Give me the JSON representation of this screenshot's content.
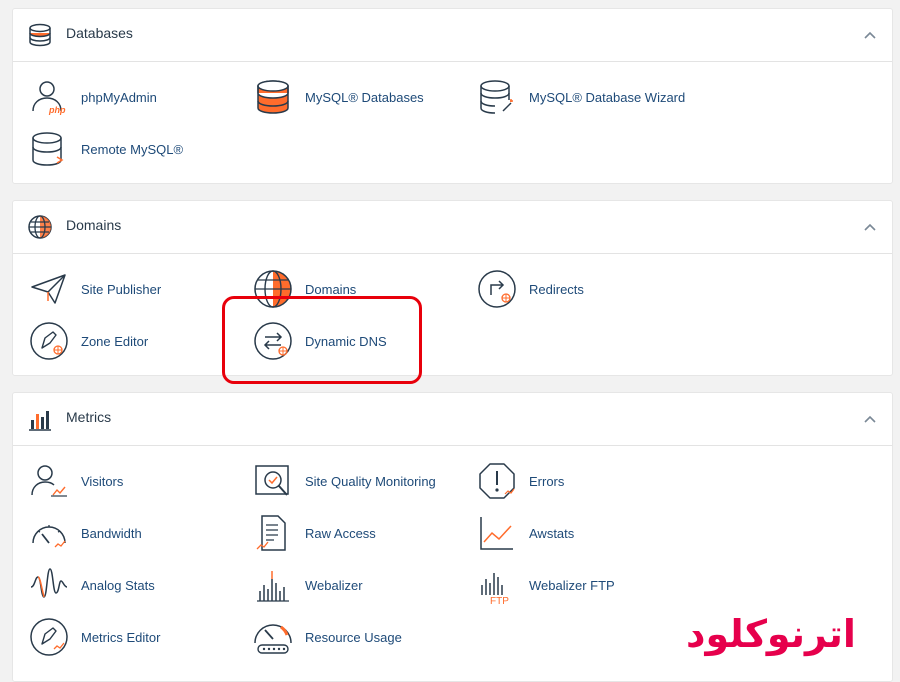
{
  "colors": {
    "accent": "#ff6c2c",
    "link": "#1e4a78",
    "highlight": "#e8000b",
    "watermark": "#e6004c"
  },
  "sections": [
    {
      "title": "Databases",
      "icon": "database-icon",
      "items": [
        {
          "label": "phpMyAdmin",
          "icon": "phpmyadmin-icon"
        },
        {
          "label": "MySQL® Databases",
          "icon": "mysql-databases-icon"
        },
        {
          "label": "MySQL® Database Wizard",
          "icon": "mysql-wizard-icon"
        },
        {
          "label": "Remote MySQL®",
          "icon": "remote-mysql-icon"
        }
      ]
    },
    {
      "title": "Domains",
      "icon": "globe-icon",
      "items": [
        {
          "label": "Site Publisher",
          "icon": "paper-plane-icon"
        },
        {
          "label": "Domains",
          "icon": "domains-globe-icon"
        },
        {
          "label": "Redirects",
          "icon": "redirect-icon"
        },
        {
          "label": "Zone Editor",
          "icon": "zone-editor-icon"
        },
        {
          "label": "Dynamic DNS",
          "icon": "dynamic-dns-icon"
        }
      ]
    },
    {
      "title": "Metrics",
      "icon": "bar-chart-icon",
      "items": [
        {
          "label": "Visitors",
          "icon": "visitors-icon"
        },
        {
          "label": "Site Quality Monitoring",
          "icon": "site-quality-icon"
        },
        {
          "label": "Errors",
          "icon": "errors-icon"
        },
        {
          "label": "Bandwidth",
          "icon": "bandwidth-icon"
        },
        {
          "label": "Raw Access",
          "icon": "raw-access-icon"
        },
        {
          "label": "Awstats",
          "icon": "awstats-icon"
        },
        {
          "label": "Analog Stats",
          "icon": "analog-stats-icon"
        },
        {
          "label": "Webalizer",
          "icon": "webalizer-icon"
        },
        {
          "label": "Webalizer FTP",
          "icon": "webalizer-ftp-icon"
        },
        {
          "label": "Metrics Editor",
          "icon": "metrics-editor-icon"
        },
        {
          "label": "Resource Usage",
          "icon": "resource-usage-icon"
        }
      ]
    }
  ],
  "watermark": "اترنوکلود"
}
